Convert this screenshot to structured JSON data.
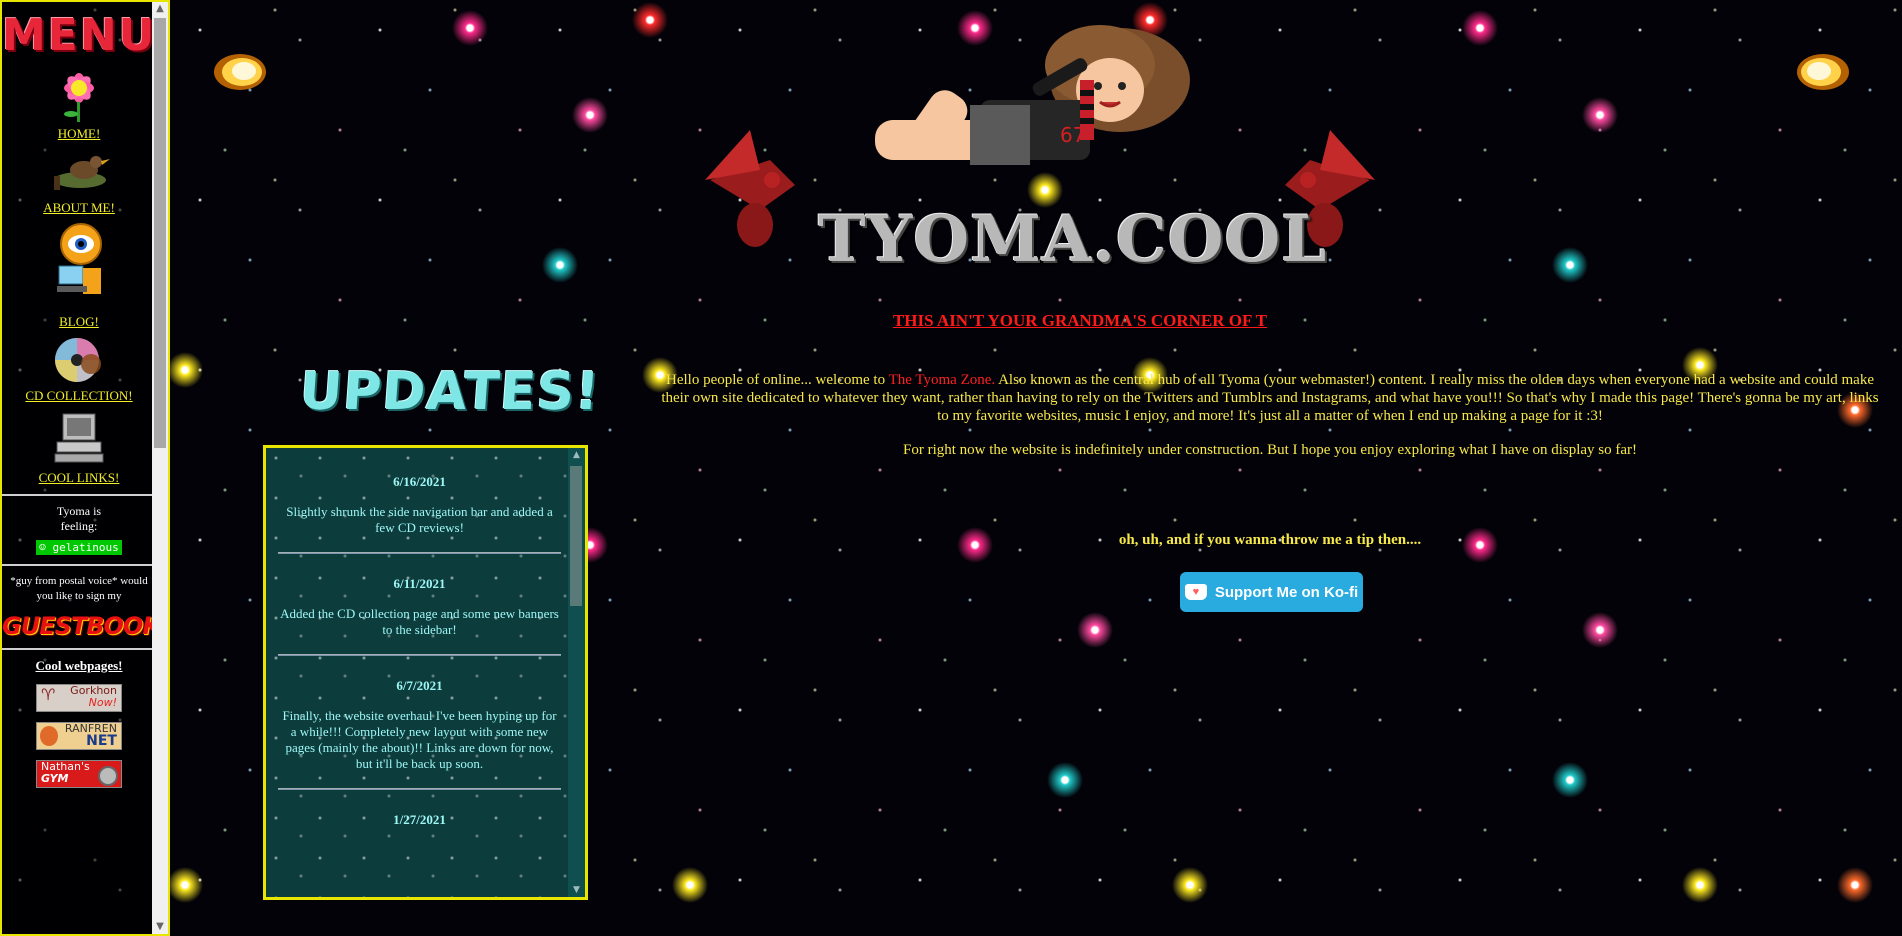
{
  "sidebar": {
    "menu_title": "MENU",
    "nav": [
      {
        "label": "HOME!",
        "icon": "flower-icon"
      },
      {
        "label": "ABOUT ME!",
        "icon": "bird-icon"
      },
      {
        "label": "BLOG!",
        "icon": "eye-computer-icon"
      },
      {
        "label": "CD COLLECTION!",
        "icon": "cd-icon"
      },
      {
        "label": "COOL LINKS!",
        "icon": "computer-icon"
      }
    ],
    "status_label": "Tyoma is feeling:",
    "status_value": "gelatinous",
    "guestbook_prompt": "*guy from postal voice* would you like to sign my",
    "guestbook_label": "GUESTBOOK?",
    "cool_webpages_title": "Cool webpages!",
    "buttons": [
      {
        "line1": "Gorkhon",
        "line2": "Now!"
      },
      {
        "line1": "RANFREN",
        "line2": "NET"
      },
      {
        "line1": "Nathan's",
        "line2": "GYM"
      }
    ]
  },
  "header": {
    "site_title": "TYOMA.COOL",
    "tagline": "THIS AIN'T YOUR GRANDMA'S CORNER OF T"
  },
  "intro": {
    "p1_before": "Hello people of online... welcome to ",
    "p1_highlight": "The Tyoma Zone.",
    "p1_after": " Also known as the central hub of all Tyoma (your webmaster!) content. I really miss the olden days when everyone had a website and could make their own site dedicated to whatever they want, rather than having to rely on the Twitters and Tumblrs and Instagrams, and what have you!!! So that's why I made this page! There's gonna be my art, links to my favorite websites, music I enjoy, and more! It's just all a matter of when I end up making a page for it :3!",
    "p2": "For right now the website is indefinitely under construction. But I hope you enjoy exploring what I have on display so far!"
  },
  "tip": {
    "text": "oh, uh, and if you wanna throw me a tip then....",
    "kofi_label": "Support Me on Ko-fi"
  },
  "updates": {
    "title": "UPDATES!",
    "entries": [
      {
        "date": "6/16/2021",
        "text": "Slightly shrunk the side navigation bar and added a few CD reviews!"
      },
      {
        "date": "6/11/2021",
        "text": "Added the CD collection page and some new banners to the sidebar!"
      },
      {
        "date": "6/7/2021",
        "text": "Finally, the website overhaul I've been hyping up for a while!!! Completely new layout with some new pages (mainly the about)!! Links are down for now, but it'll be back up soon."
      },
      {
        "date": "1/27/2021",
        "text": ""
      }
    ]
  },
  "colors": {
    "accent_yellow": "#e8e600",
    "link_yellow": "#f2ef28",
    "title_red": "#ff1a1a",
    "kofi_blue": "#29abe0",
    "updates_cyan": "#9ff7f7",
    "updates_bg": "#0c3c3c"
  }
}
